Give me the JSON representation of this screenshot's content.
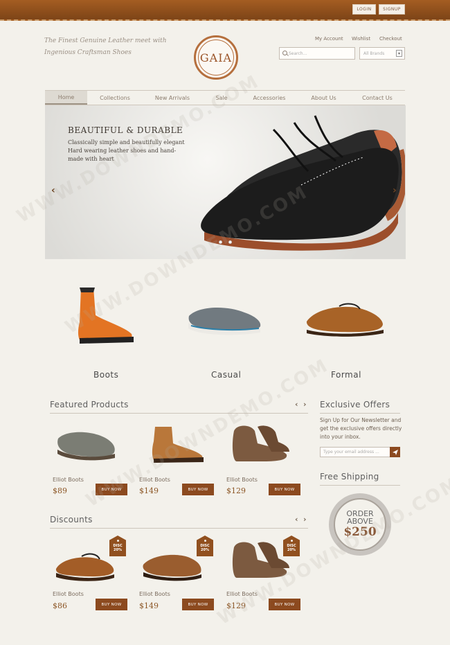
{
  "topbar": {
    "login": "LOGIN",
    "signup": "SIGNUP"
  },
  "header": {
    "tagline_line1": "The Finest Genuine Leather meet with",
    "tagline_line2": "Ingenious Craftsman Shoes",
    "logo": "GAIA",
    "links": [
      "My Account",
      "Wishlist",
      "Checkout"
    ],
    "search_placeholder": "Search...",
    "brand_select": "All Brands"
  },
  "nav": [
    "Home",
    "Collections",
    "New Arrivals",
    "Sale",
    "Accessories",
    "About Us",
    "Contact Us"
  ],
  "hero": {
    "title": "BEAUTIFUL & DURABLE",
    "text": "Classically simple and beautifully elegant Hard wearing leather shoes and hand-made with heart",
    "prev": "‹",
    "next": "›"
  },
  "categories": [
    "Boots",
    "Casual",
    "Formal"
  ],
  "featured": {
    "title": "Featured Products",
    "products": [
      {
        "name": "Elliot Boots",
        "price": "$89",
        "button": "BUY NOW"
      },
      {
        "name": "Elliot Boots",
        "price": "$149",
        "button": "BUY NOW"
      },
      {
        "name": "Elliot Boots",
        "price": "$129",
        "button": "BUY NOW"
      }
    ]
  },
  "discounts": {
    "title": "Discounts",
    "tag_line1": "DISC",
    "tag_line2": "20%",
    "products": [
      {
        "name": "Elliot Boots",
        "price": "$86",
        "button": "BUY NOW"
      },
      {
        "name": "Elliot Boots",
        "price": "$149",
        "button": "BUY NOW"
      },
      {
        "name": "Elliot Boots",
        "price": "$129",
        "button": "BUY NOW"
      }
    ]
  },
  "sidebar": {
    "offers_title": "Exclusive Offers",
    "offers_text": "Sign Up for Our Newsletter and get the exclusive offers directly into your inbox.",
    "email_placeholder": "Type your email address ...",
    "shipping_title": "Free Shipping",
    "seal_line1": "ORDER",
    "seal_line2": "ABOVE",
    "seal_amount": "$250"
  },
  "watermark": "WWW.DOWNDEMO.COM",
  "colors": {
    "accent": "#8c4a1f",
    "background": "#f3f1eb",
    "topbar": "#8f4f1c"
  }
}
